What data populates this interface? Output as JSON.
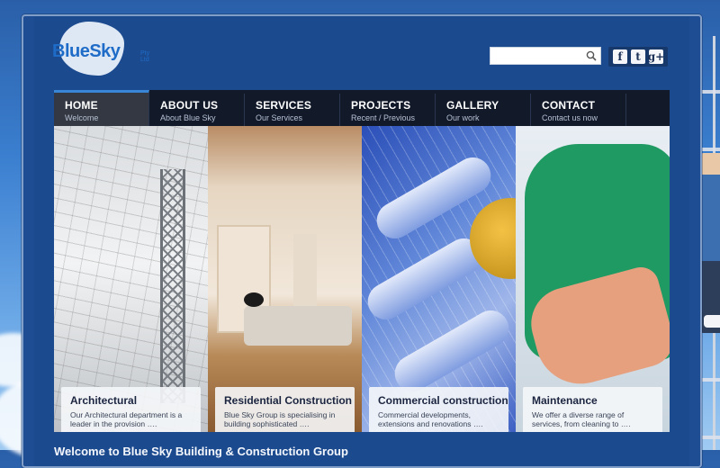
{
  "logo": {
    "brand_part1": "Blue",
    "brand_part2": "Sky",
    "suffix": "Pty Ltd"
  },
  "search": {
    "placeholder": ""
  },
  "social": [
    {
      "name": "facebook",
      "glyph": "f"
    },
    {
      "name": "twitter",
      "glyph": "t"
    },
    {
      "name": "google-plus",
      "glyph": "g+"
    }
  ],
  "nav": [
    {
      "label": "HOME",
      "sub": "Welcome",
      "active": true
    },
    {
      "label": "ABOUT US",
      "sub": "About Blue Sky"
    },
    {
      "label": "SERVICES",
      "sub": "Our Services"
    },
    {
      "label": "PROJECTS",
      "sub": "Recent / Previous"
    },
    {
      "label": "GALLERY",
      "sub": "Our work"
    },
    {
      "label": "CONTACT",
      "sub": "Contact us now"
    }
  ],
  "panels": [
    {
      "title": "Architectural",
      "desc": "Our Architectural department is a leader in the provision …."
    },
    {
      "title": "Residential Construction",
      "desc": "Blue Sky Group is specialising in building sophisticated …."
    },
    {
      "title": "Commercial construction",
      "desc": "Commercial developments, extensions and renovations …."
    },
    {
      "title": "Maintenance",
      "desc": "We offer a diverse range of services, from cleaning to …."
    }
  ],
  "welcome": "Welcome to Blue Sky Building & Construction Group",
  "colors": {
    "nav_active_accent": "#3a86d6",
    "frame": "#1f4d93"
  }
}
